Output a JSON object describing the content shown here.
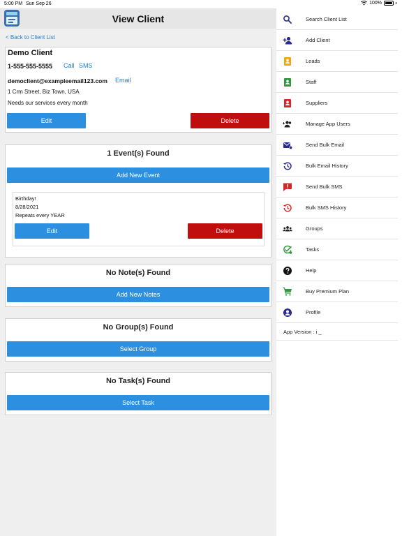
{
  "status_bar": {
    "time": "5:00 PM",
    "date": "Sun Sep 26",
    "battery": "100%"
  },
  "header": {
    "title": "View Client"
  },
  "back_link": "< Back to Client List",
  "client": {
    "name": "Demo Client",
    "phone": "1-555-555-5555",
    "call_label": "Call",
    "sms_label": "SMS",
    "email": "democlient@exampleemail123.com",
    "email_label": "Email",
    "address": "1 Crm Street, Biz Town, USA",
    "notes": "Needs our services every month",
    "edit_label": "Edit",
    "delete_label": "Delete"
  },
  "events": {
    "title": "1 Event(s) Found",
    "add_label": "Add New Event",
    "items": [
      {
        "name": "Birthday!",
        "date": "8/28/2021",
        "repeat": "Repeats every YEAR",
        "edit_label": "Edit",
        "delete_label": "Delete"
      }
    ]
  },
  "notes": {
    "title": "No Note(s) Found",
    "add_label": "Add New Notes"
  },
  "groups": {
    "title": "No Group(s) Found",
    "select_label": "Select Group"
  },
  "tasks": {
    "title": "No Task(s) Found",
    "select_label": "Select Task"
  },
  "sidebar": {
    "items": [
      {
        "label": "Search Client List",
        "icon": "search-icon"
      },
      {
        "label": "Add Client",
        "icon": "add-person-icon"
      },
      {
        "label": "Leads",
        "icon": "contact-card-icon"
      },
      {
        "label": "Staff",
        "icon": "contact-card-icon"
      },
      {
        "label": "Suppliers",
        "icon": "contact-card-icon"
      },
      {
        "label": "Manage App Users",
        "icon": "people-add-icon"
      },
      {
        "label": "Send Bulk Email",
        "icon": "bulk-email-icon"
      },
      {
        "label": "Bulk Email History",
        "icon": "history-icon"
      },
      {
        "label": "Send Bulk SMS",
        "icon": "sms-alert-icon"
      },
      {
        "label": "Bulk SMS History",
        "icon": "history-icon"
      },
      {
        "label": "Groups",
        "icon": "groups-icon"
      },
      {
        "label": "Tasks",
        "icon": "task-check-icon"
      },
      {
        "label": "Help",
        "icon": "help-icon"
      },
      {
        "label": "Buy Premium Plan",
        "icon": "cart-icon"
      },
      {
        "label": "Profile",
        "icon": "profile-icon"
      }
    ],
    "app_version": "App Version : i _"
  },
  "colors": {
    "accent_blue": "#2c8fe0",
    "danger_red": "#c00d0d",
    "link_blue": "#1e7fd6",
    "icon_navy": "#2a2a8c",
    "icon_orange": "#f3a21b",
    "icon_green": "#2e9a3e",
    "icon_red": "#d72626"
  }
}
